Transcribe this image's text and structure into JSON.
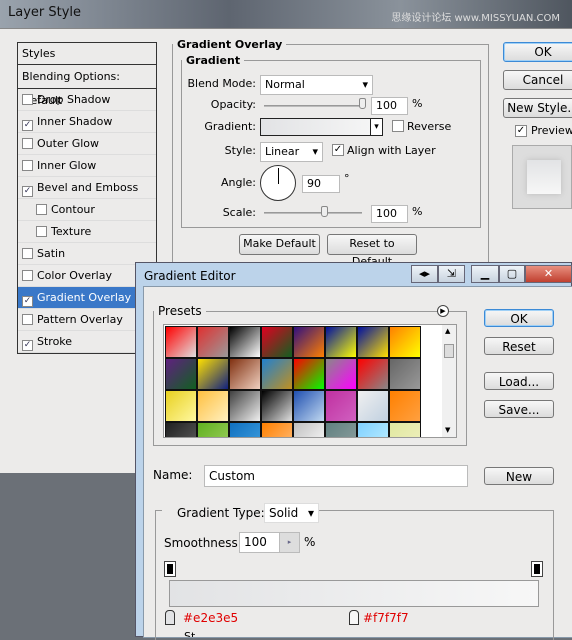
{
  "layer_style": {
    "title": "Layer Style",
    "watermark": "思缘设计论坛 www.MISSYUAN.COM",
    "styles_header": "Styles",
    "blending": "Blending Options: Default",
    "items": [
      {
        "label": "Drop Shadow",
        "checked": false,
        "sub": false
      },
      {
        "label": "Inner Shadow",
        "checked": true,
        "sub": false
      },
      {
        "label": "Outer Glow",
        "checked": false,
        "sub": false
      },
      {
        "label": "Inner Glow",
        "checked": false,
        "sub": false
      },
      {
        "label": "Bevel and Emboss",
        "checked": true,
        "sub": false
      },
      {
        "label": "Contour",
        "checked": false,
        "sub": true
      },
      {
        "label": "Texture",
        "checked": false,
        "sub": true
      },
      {
        "label": "Satin",
        "checked": false,
        "sub": false
      },
      {
        "label": "Color Overlay",
        "checked": false,
        "sub": false
      },
      {
        "label": "Gradient Overlay",
        "checked": true,
        "sub": false,
        "selected": true
      },
      {
        "label": "Pattern Overlay",
        "checked": false,
        "sub": false
      },
      {
        "label": "Stroke",
        "checked": true,
        "sub": false
      }
    ],
    "section": "Gradient Overlay",
    "group": "Gradient",
    "blend_mode_label": "Blend Mode:",
    "blend_mode": "Normal",
    "opacity_label": "Opacity:",
    "opacity": "100",
    "opacity_pct": 100,
    "pct": "%",
    "gradient_label": "Gradient:",
    "reverse": "Reverse",
    "reverse_checked": false,
    "style_label": "Style:",
    "style": "Linear",
    "align": "Align with Layer",
    "align_checked": true,
    "angle_label": "Angle:",
    "angle": "90",
    "deg": "°",
    "scale_label": "Scale:",
    "scale": "100",
    "scale_pct": 100,
    "make_default": "Make Default",
    "reset_default": "Reset to Default",
    "ok": "OK",
    "cancel": "Cancel",
    "new_style": "New Style...",
    "preview": "Preview",
    "preview_checked": true
  },
  "gradient_editor": {
    "title": "Gradient Editor",
    "presets_label": "Presets",
    "ok": "OK",
    "reset": "Reset",
    "load": "Load...",
    "save": "Save...",
    "name_label": "Name:",
    "name": "Custom",
    "new": "New",
    "type_label": "Gradient Type:",
    "type": "Solid",
    "smooth_label": "Smoothness:",
    "smooth": "100",
    "pct": "%",
    "stop_left": "#e2e3e5",
    "stop_right": "#f7f7f7",
    "partial_label": "St",
    "presets": [
      [
        "#ff0000",
        "#e0e0e0"
      ],
      [
        "#e03030",
        "#9a9a9a"
      ],
      [
        "#000000",
        "#ffffff"
      ],
      [
        "#e00020",
        "#106020"
      ],
      [
        "#301080",
        "#ff8000"
      ],
      [
        "#0010a0",
        "#ffff00"
      ],
      [
        "#0010a0",
        "#ffe000"
      ],
      [
        "#ff8000",
        "#ffff00"
      ],
      [
        "#602080",
        "#106020"
      ],
      [
        "#ffe000",
        "#102080"
      ],
      [
        "#803010",
        "#f0d0c0"
      ],
      [
        "#2080d0",
        "#c09020"
      ],
      [
        "#ff0000",
        "#00ff00"
      ],
      [
        "#888888",
        "#ff00ff"
      ],
      [
        "#ff0000",
        "#888888"
      ],
      [
        "#666666",
        "#999999"
      ],
      [
        "#e8d020",
        "#fff8a0"
      ],
      [
        "#ffc040",
        "#fff0c0"
      ],
      [
        "#404040",
        "#f0f0f0"
      ],
      [
        "#000000",
        "#e0e0e0"
      ],
      [
        "#2050b0",
        "#c0d8f0"
      ],
      [
        "#c030a0",
        "#d060c0"
      ],
      [
        "#f0f0f0",
        "#c0d0e0"
      ],
      [
        "#ff8000",
        "#ffa040"
      ],
      [
        "#202020",
        "#606060"
      ],
      [
        "#60b020",
        "#a0d060"
      ],
      [
        "#1070c0",
        "#40a0e0"
      ],
      [
        "#ff8000",
        "#ffc080"
      ],
      [
        "#c0c0c0",
        "#ffffff"
      ],
      [
        "#608080",
        "#90a0a0"
      ],
      [
        "#80d0ff",
        "#c0f0ff"
      ],
      [
        "#e0e8a0",
        "#f0f0c0"
      ]
    ]
  }
}
